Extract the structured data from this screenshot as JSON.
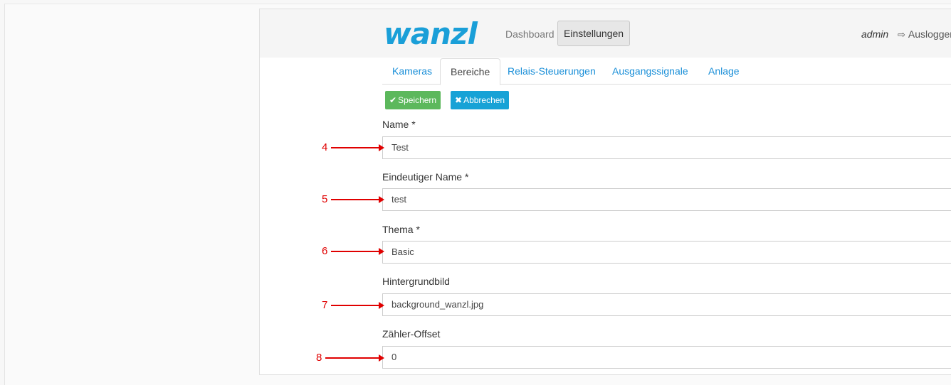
{
  "navbar": {
    "logo_text": "wanzl",
    "dashboard_label": "Dashboard",
    "einstellungen_label": "Einstellungen",
    "user": "admin",
    "logout_label": "Ausloggen",
    "logout_icon": "sign-out-icon"
  },
  "tabs": [
    {
      "label": "Kameras",
      "active": false
    },
    {
      "label": "Bereiche",
      "active": true
    },
    {
      "label": "Relais-Steuerungen",
      "active": false
    },
    {
      "label": "Ausgangssignale",
      "active": false
    },
    {
      "label": "Anlage",
      "active": false
    }
  ],
  "actions": {
    "save_label": "Speichern",
    "save_icon": "check-icon",
    "cancel_label": "Abbrechen",
    "cancel_icon": "times-icon"
  },
  "form": {
    "name": {
      "label": "Name *",
      "value": "Test"
    },
    "unique_name": {
      "label": "Eindeutiger Name *",
      "value": "test"
    },
    "theme": {
      "label": "Thema *",
      "value": "Basic"
    },
    "background": {
      "label": "Hintergrundbild",
      "value": "background_wanzl.jpg"
    },
    "counter_offset": {
      "label": "Zähler-Offset",
      "value": "0"
    }
  },
  "annotations": [
    "4",
    "5",
    "6",
    "7",
    "8"
  ],
  "colors": {
    "brand": "#1a9fd8",
    "success": "#5cb85c",
    "info": "#17a2d6",
    "annotation": "#e00000",
    "link": "#1a8fd8"
  }
}
